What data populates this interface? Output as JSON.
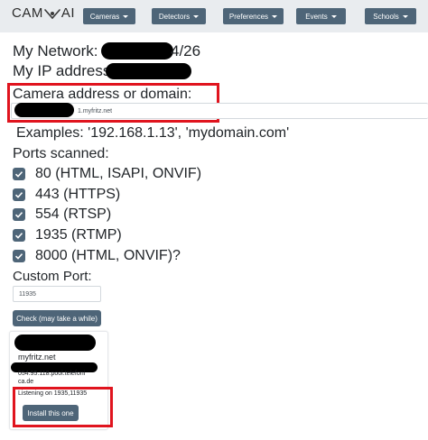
{
  "app": {
    "logo_left": "CAM",
    "logo_right": "AI"
  },
  "nav": {
    "items": [
      {
        "label": "Cameras"
      },
      {
        "label": "Detectors"
      },
      {
        "label": "Preferences"
      },
      {
        "label": "Events"
      },
      {
        "label": "Schools"
      }
    ]
  },
  "network": {
    "label": "My Network:",
    "value_suffix": "4/26"
  },
  "ip": {
    "label": "My IP address:"
  },
  "camera_address": {
    "label": "Camera address or domain:",
    "value_suffix": "1.myfritz.net"
  },
  "examples": "Examples: '192.168.1.13', 'mydomain.com'",
  "ports": {
    "heading": "Ports scanned:",
    "items": [
      {
        "label": "80 (HTML, ISAPI, ONVIF)",
        "checked": true
      },
      {
        "label": "443 (HTTPS)",
        "checked": true
      },
      {
        "label": "554 (RTSP)",
        "checked": true
      },
      {
        "label": "1935 (RTMP)",
        "checked": true
      },
      {
        "label": "8000 (HTML, ONVIF)?",
        "checked": true
      }
    ]
  },
  "custom_port": {
    "label": "Custom Port:",
    "value": "11935"
  },
  "check_button": "Check (may take a while)",
  "result": {
    "host_name": "myfritz.net",
    "host_line1": "054.95.118.pool.telefoni",
    "host_line2": "ca.de",
    "listening": "Listening on 1935,11935",
    "install_button": "Install this one"
  },
  "colors": {
    "accent": "#4e6578",
    "highlight": "#e0141e",
    "navbar_bg": "#e9ecef"
  }
}
